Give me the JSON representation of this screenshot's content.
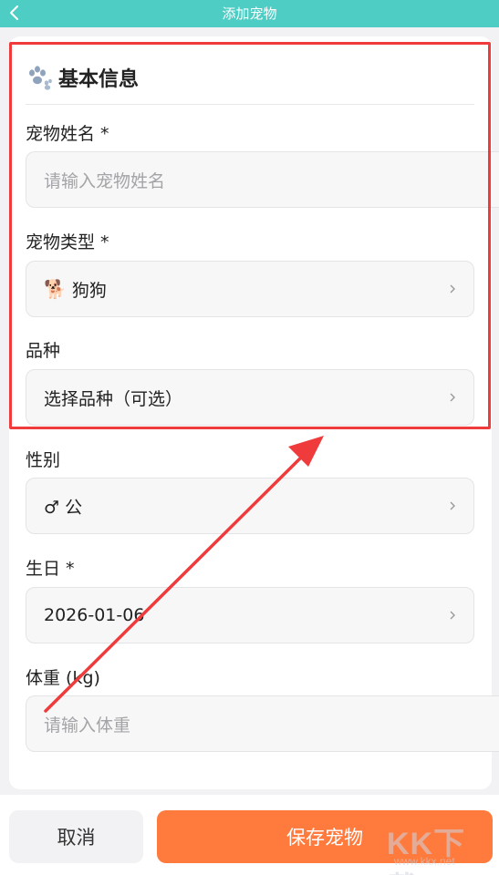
{
  "header": {
    "title": "添加宠物",
    "back_icon": "chevron-left-icon"
  },
  "section": {
    "title": "基本信息",
    "icon": "paw-icon"
  },
  "fields": {
    "pet_name": {
      "label": "宠物姓名 *",
      "placeholder": "请输入宠物姓名"
    },
    "pet_type": {
      "label": "宠物类型 *",
      "value": "狗狗",
      "emoji": "🐕"
    },
    "breed": {
      "label": "品种",
      "value": "选择品种（可选）"
    },
    "gender": {
      "label": "性别",
      "value": "♂ 公"
    },
    "birthday": {
      "label": "生日 *",
      "value": "2026-01-06"
    },
    "weight": {
      "label": "体重 (kg)",
      "placeholder": "请输入体重"
    }
  },
  "buttons": {
    "cancel": "取消",
    "save": "保存宠物"
  },
  "annotation": {
    "highlight_color": "#ef3b3b"
  },
  "watermark": {
    "logo": "KK下载",
    "url": "www.kkx.net"
  },
  "colors": {
    "header": "#4ecdc4",
    "save_button": "#ff7a3d"
  }
}
